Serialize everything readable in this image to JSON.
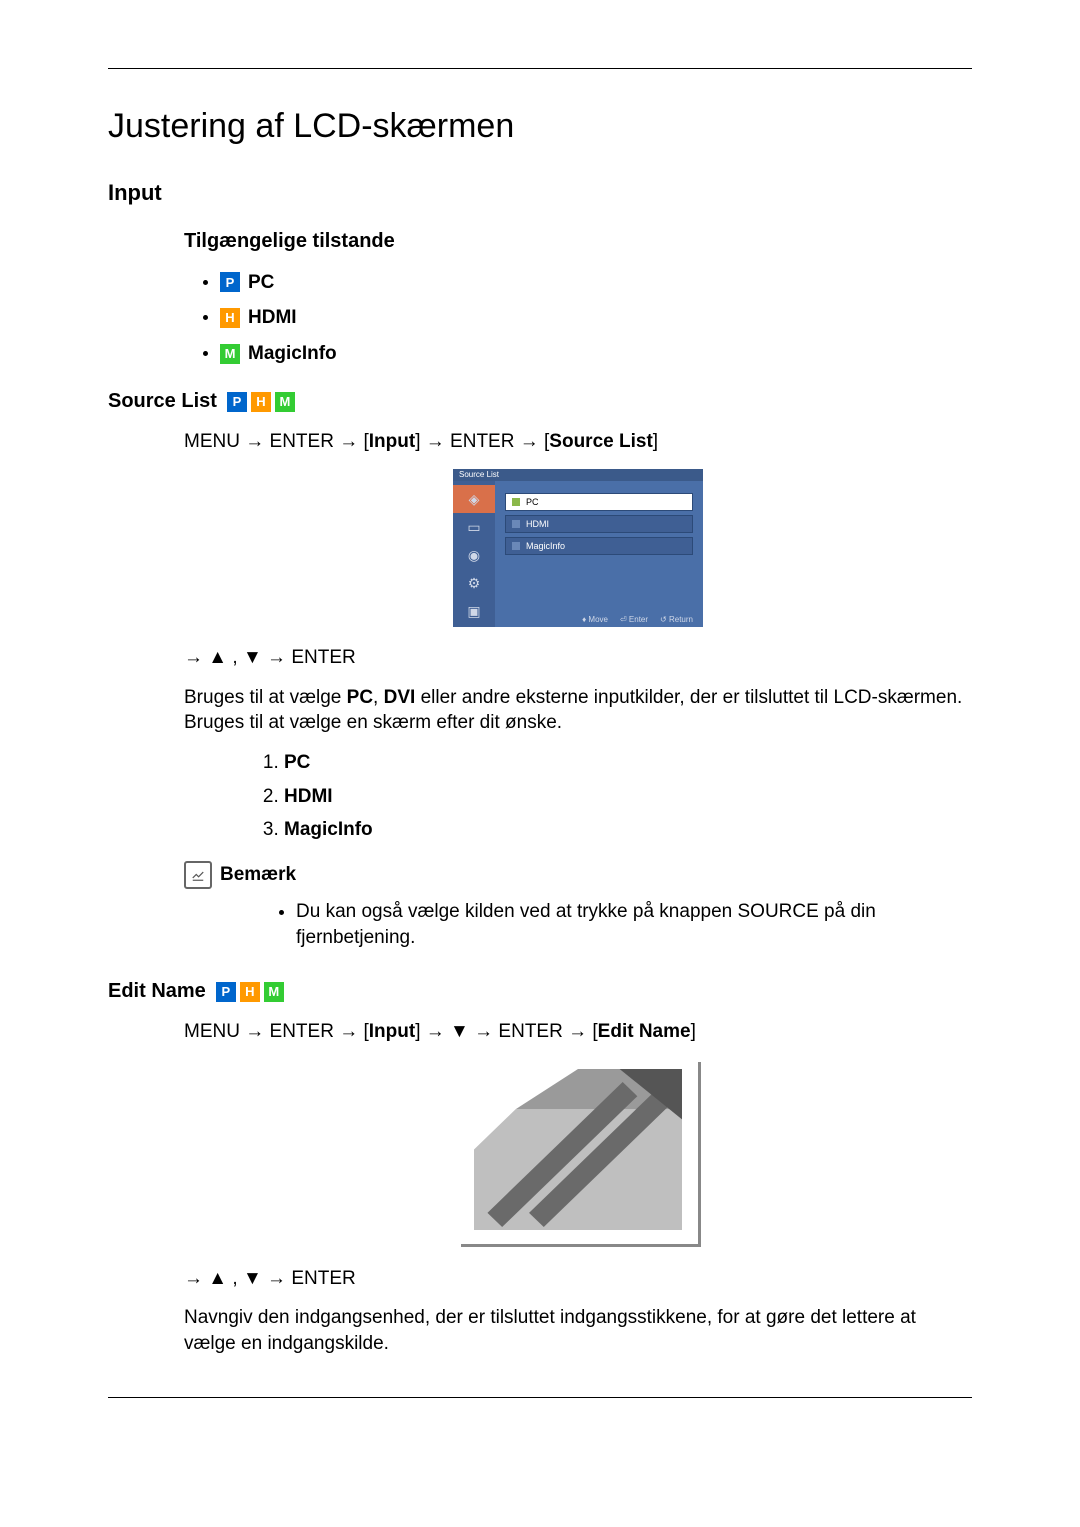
{
  "page": {
    "title": "Justering af LCD-skærmen"
  },
  "section_input": {
    "heading": "Input",
    "modes_heading": "Tilgængelige tilstande",
    "modes": {
      "pc": "PC",
      "hdmi": "HDMI",
      "magicinfo": "MagicInfo"
    }
  },
  "section_source": {
    "heading": "Source List",
    "nav_menu": "MENU",
    "nav_enter1": "ENTER",
    "nav_input": "Input",
    "nav_enter2": "ENTER",
    "nav_target": "Source List",
    "osd_title": "Source List",
    "osd_items": {
      "pc": "PC",
      "hdmi": "HDMI",
      "magicinfo": "MagicInfo"
    },
    "osd_foot_move": "Move",
    "osd_foot_enter": "Enter",
    "osd_foot_return": "Return",
    "nav_arrows_enter": "ENTER",
    "body_a": "Bruges til at vælge ",
    "body_pc": "PC",
    "body_comma": ", ",
    "body_dvi": "DVI",
    "body_b": " eller andre eksterne inputkilder, der er tilsluttet til LCD-skærmen. Bruges til at vælge en skærm efter dit ønske.",
    "list": {
      "i1": "PC",
      "i2": "HDMI",
      "i3": "MagicInfo"
    },
    "note_label": "Bemærk",
    "note_text": "Du kan også vælge kilden ved at trykke på knappen SOURCE på din fjernbetjening."
  },
  "section_edit": {
    "heading": "Edit Name",
    "nav_menu": "MENU",
    "nav_enter1": "ENTER",
    "nav_input": "Input",
    "nav_enter2": "ENTER",
    "nav_target": "Edit Name",
    "nav_arrows_enter": "ENTER",
    "body": "Navngiv den indgangsenhed, der er tilsluttet indgangsstikkene, for at gøre det lettere at vælge en indgangskilde."
  }
}
